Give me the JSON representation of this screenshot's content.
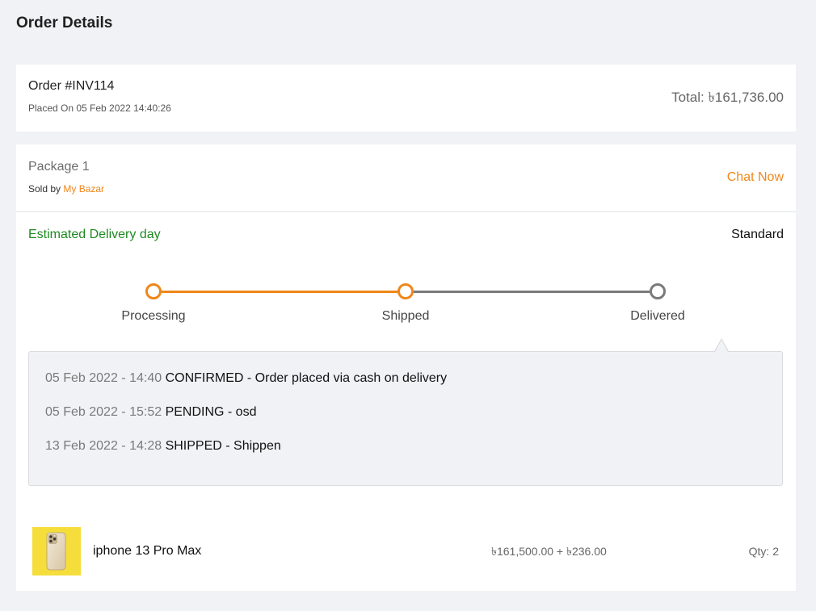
{
  "page": {
    "title": "Order Details"
  },
  "order": {
    "number": "Order #INV114",
    "placed_on": "Placed On 05 Feb 2022 14:40:26",
    "total": "Total: ৳161,736.00"
  },
  "package": {
    "name": "Package 1",
    "sold_by_label": "Sold by",
    "seller": "My Bazar",
    "chat_label": "Chat Now",
    "delivery_label": "Estimated Delivery day",
    "delivery_type": "Standard",
    "steps": [
      {
        "label": "Processing",
        "reached": true
      },
      {
        "label": "Shipped",
        "reached": true
      },
      {
        "label": "Delivered",
        "reached": false
      }
    ],
    "history": [
      {
        "time": "05 Feb 2022 - 14:40",
        "status": "CONFIRMED - Order placed via cash on delivery"
      },
      {
        "time": "05 Feb 2022 - 15:52",
        "status": "PENDING - osd"
      },
      {
        "time": "13 Feb 2022 - 14:28",
        "status": "SHIPPED - Shippen"
      }
    ],
    "items": [
      {
        "name": "iphone 13 Pro Max",
        "price": "৳161,500.00 + ৳236.00",
        "qty": "Qty: 2",
        "icon": "iphone-icon"
      }
    ]
  },
  "colors": {
    "accent": "#f0861a",
    "success": "#1e8a22",
    "pending": "#7a7a7a",
    "page_background": "#f0f2f5",
    "thumbnail_background": "#f5dd3b"
  }
}
